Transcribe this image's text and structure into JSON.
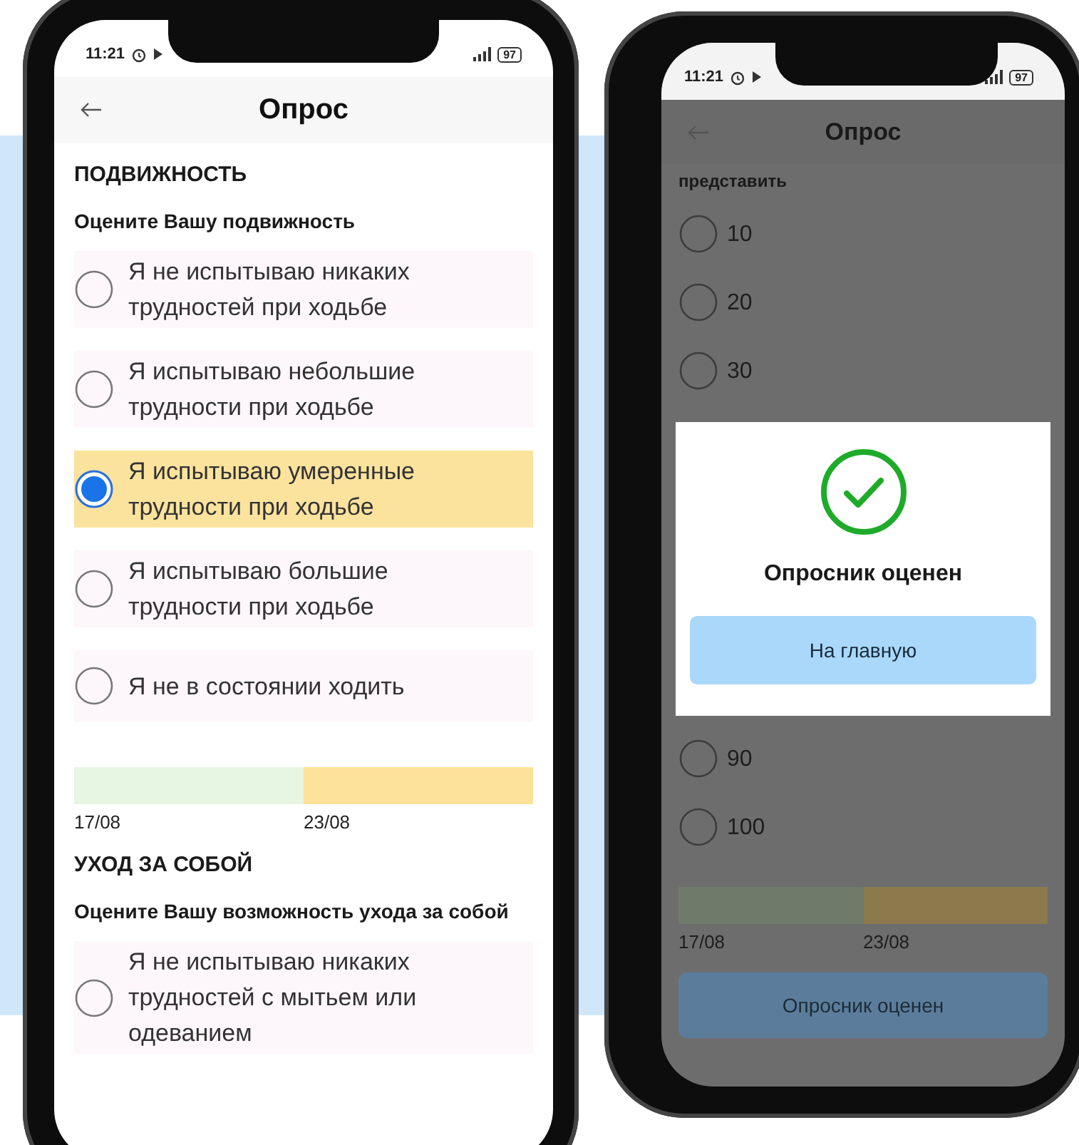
{
  "phones": [
    {
      "status_bar": {
        "time": "11:21",
        "battery": "97"
      },
      "header": {
        "title": "Опрос"
      },
      "dimmed": false,
      "blocks": [
        {
          "kind": "section",
          "title": "ПОДВИЖНОСТЬ"
        },
        {
          "kind": "question",
          "text": "Оцените Вашу подвижность"
        },
        {
          "kind": "options",
          "options": [
            {
              "label": "Я не испытываю никаких трудностей при ходьбе",
              "selected": false
            },
            {
              "label": "Я испытываю небольшие трудности при ходьбе",
              "selected": false
            },
            {
              "label": "Я испытываю умеренные трудности при ходьбе",
              "selected": true
            },
            {
              "label": "Я испытываю большие трудности при ходьбе",
              "selected": false
            },
            {
              "label": "Я не в состоянии ходить",
              "selected": false
            }
          ]
        },
        {
          "kind": "timeline",
          "segments": [
            {
              "label": "17/08",
              "color": "#e7f6e2"
            },
            {
              "label": "23/08",
              "color": "#fde29a"
            }
          ]
        },
        {
          "kind": "section",
          "title": "УХОД ЗА СОБОЙ"
        },
        {
          "kind": "question",
          "text": "Оцените Вашу возможность ухода за собой"
        },
        {
          "kind": "options",
          "options": [
            {
              "label": "Я не испытываю никаких трудностей с мытьем или одеванием",
              "selected": false
            }
          ]
        }
      ]
    },
    {
      "status_bar": {
        "time": "11:21",
        "battery": "97"
      },
      "header": {
        "title": "Опрос"
      },
      "dimmed": true,
      "blocks": [
        {
          "kind": "question",
          "text": "представить"
        },
        {
          "kind": "options",
          "options": [
            {
              "label": "10",
              "selected": false
            },
            {
              "label": "20",
              "selected": false
            },
            {
              "label": "30",
              "selected": false
            }
          ]
        },
        {
          "kind": "dialog",
          "title": "Опросник оценен",
          "button": "На главную"
        },
        {
          "kind": "options",
          "options": [
            {
              "label": "90",
              "selected": false
            },
            {
              "label": "100",
              "selected": false
            }
          ]
        },
        {
          "kind": "timeline",
          "segments": [
            {
              "label": "17/08",
              "color": "#6f7a6b"
            },
            {
              "label": "23/08",
              "color": "#8c7a4c"
            }
          ]
        },
        {
          "kind": "submit",
          "label": "Опросник оценен"
        }
      ]
    }
  ]
}
